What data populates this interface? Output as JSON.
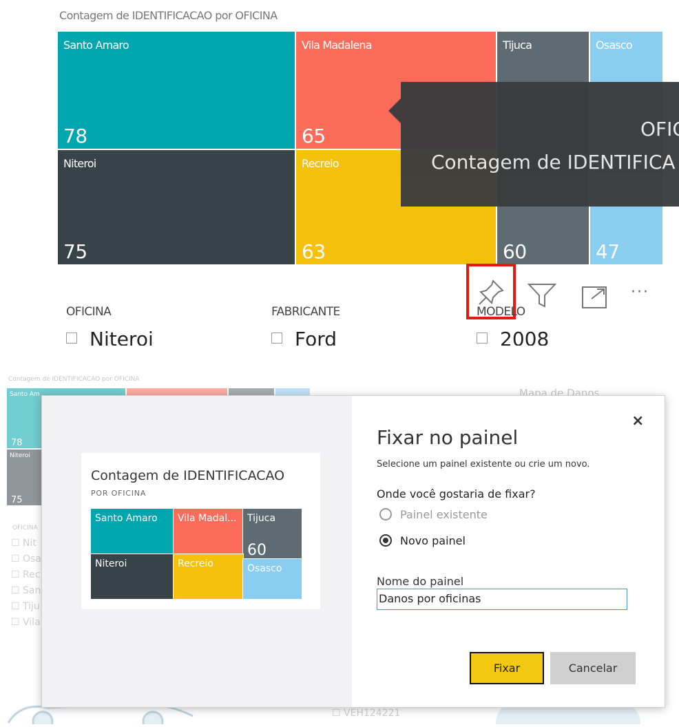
{
  "top_visual": {
    "title": "Contagem de IDENTIFICACAO por OFICINA",
    "tiles": [
      {
        "label": "Santo Amaro",
        "value": "78",
        "color": "#00a6ad"
      },
      {
        "label": "Vila Madalena",
        "value": "65",
        "color": "#fd6b5a"
      },
      {
        "label": "Tijuca",
        "value": "60",
        "color": "#5f6b73"
      },
      {
        "label": "Osasco",
        "value": "47",
        "color": "#89cdf0"
      },
      {
        "label": "Niteroi",
        "value": "75",
        "color": "#374249"
      },
      {
        "label": "Recreio",
        "value": "63",
        "color": "#f6c10b"
      }
    ],
    "tooltip": {
      "field_label": "OFIC",
      "value_label": "Contagem de IDENTIFICA"
    }
  },
  "visual_toolbar": {
    "pin_icon": "pin-icon",
    "filter_icon": "filter-icon",
    "focus_icon": "focus-mode-icon",
    "more_label": "···",
    "highlight_color": "#e01b12"
  },
  "slicers": [
    {
      "header": "OFICINA",
      "item": "Niteroi"
    },
    {
      "header": "FABRICANTE",
      "item": "Ford"
    },
    {
      "header": "MODELO",
      "item": "2008"
    }
  ],
  "background": {
    "mini_title": "Contagem de IDENTIFICACAO por OFICINA",
    "mini_tile_1": "Santo Am",
    "mini_value_1": "78",
    "mini_tile_2": "Niteroi",
    "mini_value_2": "75",
    "right_title": "Mapa de Danos",
    "slicer_header": "OFICINA",
    "slicer_items": [
      "Nit",
      "Osa",
      "Rec",
      "San",
      "Tiju",
      "Vila"
    ],
    "bottom_item": "VEH124221"
  },
  "dialog": {
    "close_label": "×",
    "title": "Fixar no painel",
    "subtitle": "Selecione um painel existente ou crie um novo.",
    "question": "Onde você gostaria de fixar?",
    "options": [
      {
        "label": "Painel existente",
        "selected": false
      },
      {
        "label": "Novo painel",
        "selected": true
      }
    ],
    "name_label": "Nome do painel",
    "name_value": "Danos por oficinas",
    "fix_button": "Fixar",
    "cancel_button": "Cancelar",
    "preview": {
      "title": "Contagem de IDENTIFICACAO",
      "subtitle": "POR OFICINA",
      "tiles": [
        {
          "label": "Santo Amaro",
          "value": ""
        },
        {
          "label": "Vila Madal...",
          "value": ""
        },
        {
          "label": "Tijuca",
          "value": "60"
        },
        {
          "label": "Niteroi",
          "value": ""
        },
        {
          "label": "Recreio",
          "value": ""
        },
        {
          "label": "Osasco",
          "value": ""
        }
      ]
    }
  }
}
